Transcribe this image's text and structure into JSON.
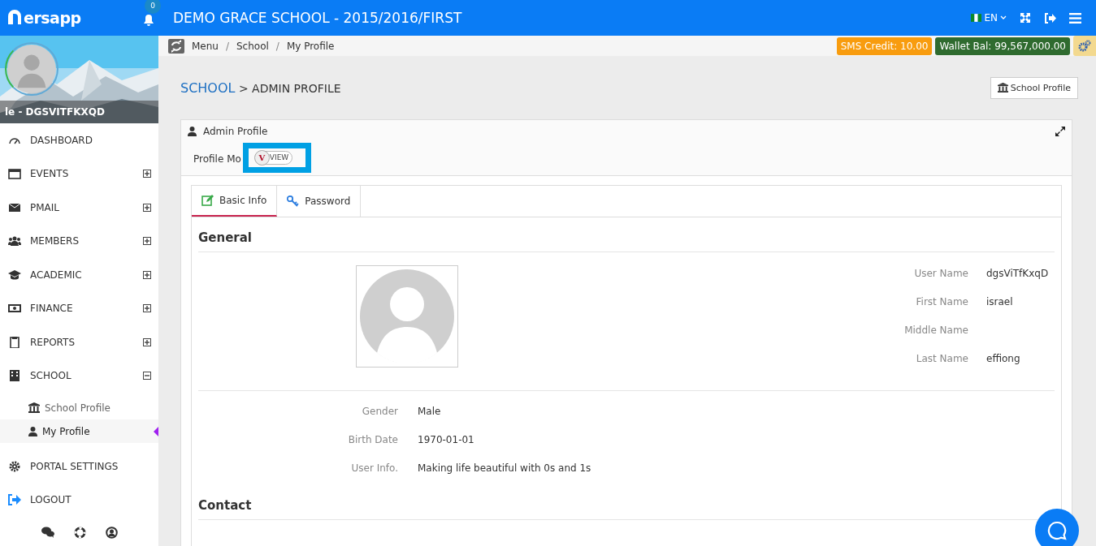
{
  "header": {
    "logo": "ersapp",
    "notifications": "0",
    "title": "DEMO GRACE SCHOOL - 2015/2016/FIRST",
    "language": "EN"
  },
  "sidebar": {
    "user": "le - DGSVITFKXQD",
    "items": [
      {
        "label": "DASHBOARD"
      },
      {
        "label": "EVENTS",
        "expanded": false
      },
      {
        "label": "PMAIL",
        "expanded": false
      },
      {
        "label": "MEMBERS",
        "expanded": false
      },
      {
        "label": "ACADEMIC",
        "expanded": false
      },
      {
        "label": "FINANCE",
        "expanded": false
      },
      {
        "label": "REPORTS",
        "expanded": false
      },
      {
        "label": "SCHOOL",
        "expanded": true,
        "children": [
          {
            "label": "School Profile",
            "selected": false
          },
          {
            "label": "My Profile",
            "selected": true
          }
        ]
      },
      {
        "label": "PORTAL SETTINGS"
      },
      {
        "label": "LOGOUT"
      }
    ]
  },
  "breadcrumb": {
    "separator": "/",
    "items": [
      "Menu",
      "School",
      "My Profile"
    ]
  },
  "badges": [
    {
      "label": "SMS Credit: 10.00",
      "color": "#f89c0e"
    },
    {
      "label": "Wallet Bal: 99,567,000.00",
      "color": "#2f6b2f"
    }
  ],
  "page_title": {
    "section": "SCHOOL",
    "sub": "> ADMIN PROFILE"
  },
  "school_profile_button": "School Profile",
  "panel": {
    "title": "Admin Profile",
    "mode_label": "Profile Mo",
    "toggle": {
      "knob": "V",
      "label": "VIEW",
      "on": false
    }
  },
  "tabs": [
    {
      "label": "Basic Info",
      "selected": true
    },
    {
      "label": "Password",
      "selected": false
    }
  ],
  "general": {
    "heading": "General",
    "names": [
      {
        "label": "User Name",
        "value": "dgsViTfKxqD"
      },
      {
        "label": "First Name",
        "value": "israel"
      },
      {
        "label": "Middle Name"
      },
      {
        "label": "Last Name",
        "value": "effiong"
      }
    ],
    "details": [
      {
        "label": "Gender",
        "value": "Male"
      },
      {
        "label": "Birth Date",
        "value": "1970-01-01"
      },
      {
        "label": "User Info.",
        "value": "Making life beautiful with 0s and 1s"
      }
    ]
  },
  "contact": {
    "heading": "Contact"
  }
}
